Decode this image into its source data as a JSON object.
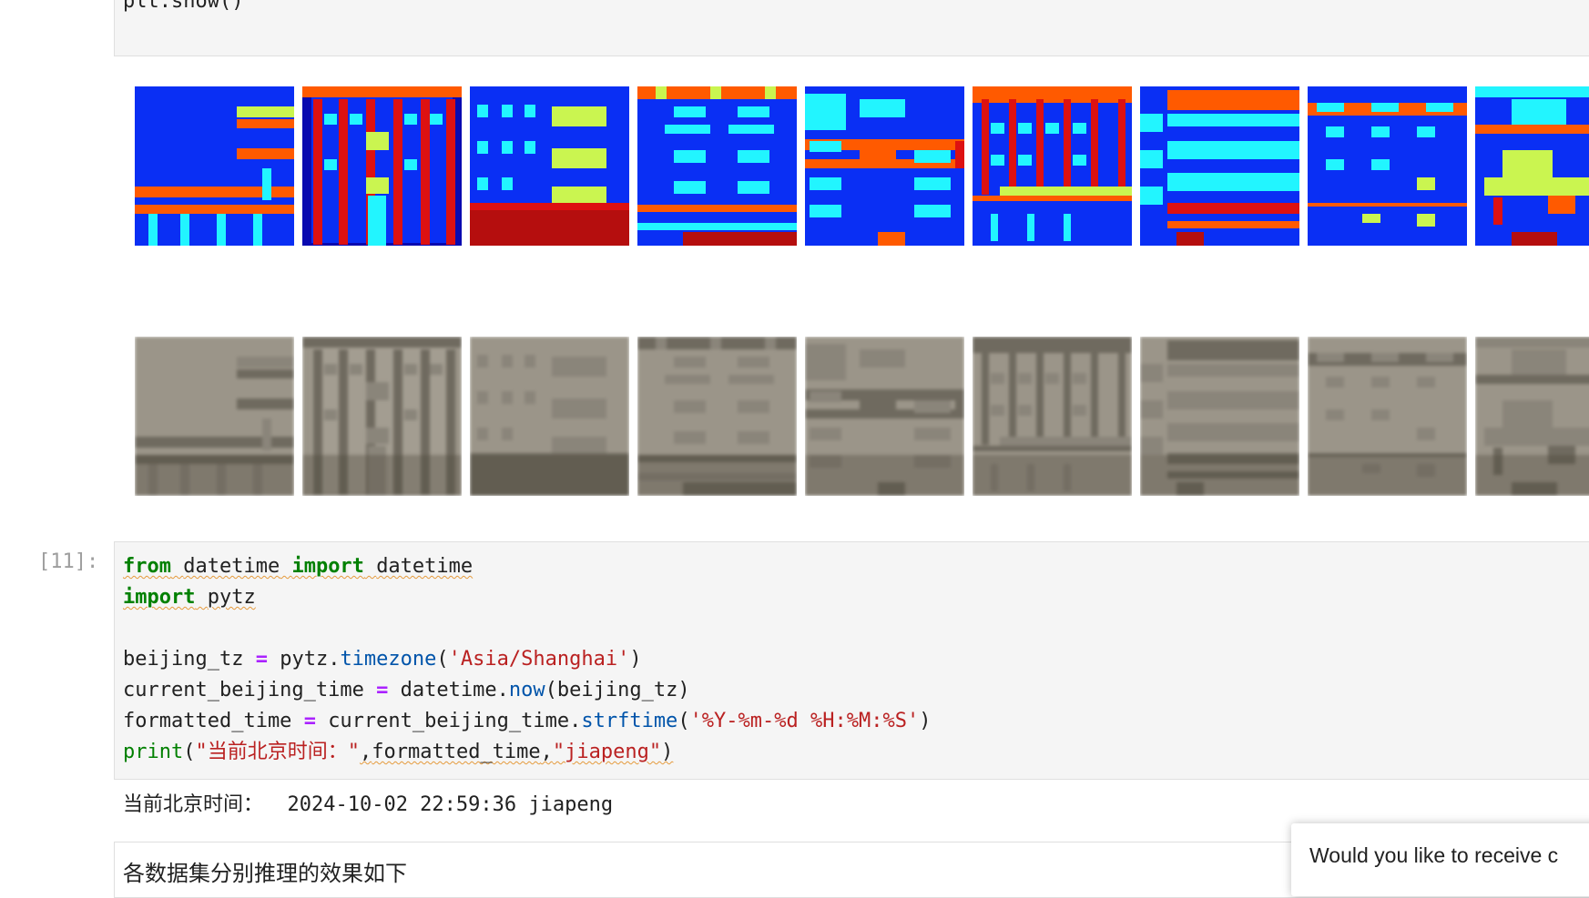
{
  "previous_cell": {
    "code_line": "plt.show()"
  },
  "figure_output": {
    "rows": [
      {
        "kind": "segmentation-label-maps",
        "tile_count": 9
      },
      {
        "kind": "generated-facade-photos",
        "tile_count": 9
      }
    ],
    "colors": {
      "blue": "#0a2ff4",
      "orange": "#ff5a00",
      "cyan": "#22f5ff",
      "yellow": "#caf550",
      "red": "#dd1111",
      "darkred": "#b50e0e",
      "navy": "#0a0ab0",
      "photo_base": "#9b9589"
    }
  },
  "cell_11": {
    "prompt": "[11]:",
    "code": {
      "line1": {
        "kw1": "from",
        "mod": "datetime",
        "kw2": "import",
        "name": "datetime"
      },
      "line2": {
        "kw": "import",
        "mod": "pytz"
      },
      "line4": {
        "var": "beijing_tz",
        "obj": "pytz",
        "method": "timezone",
        "arg": "'Asia/Shanghai'"
      },
      "line5": {
        "var": "current_beijing_time",
        "obj": "datetime",
        "method": "now",
        "arg": "beijing_tz"
      },
      "line6": {
        "var": "formatted_time",
        "obj": "current_beijing_time",
        "method": "strftime",
        "arg": "'%Y-%m-%d %H:%M:%S'"
      },
      "line7": {
        "fn": "print",
        "arg1": "\"当前北京时间：\"",
        "arg2": "formatted_time",
        "arg3": "\"jiapeng\""
      }
    },
    "output": "当前北京时间：  2024-10-02 22:59:36 jiapeng"
  },
  "markdown_cell": {
    "text": "各数据集分别推理的效果如下"
  },
  "notification": {
    "text": "Would you like to receive c"
  }
}
